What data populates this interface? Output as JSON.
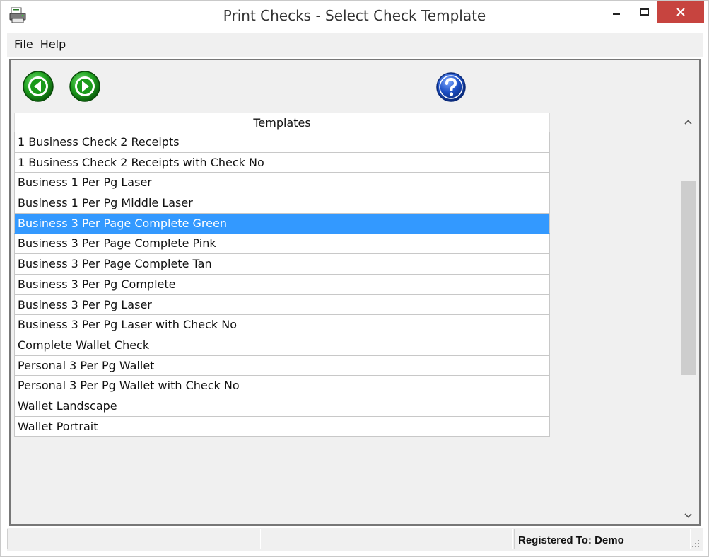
{
  "window": {
    "title": "Print Checks - Select Check Template"
  },
  "menu": {
    "items": [
      {
        "label": "File"
      },
      {
        "label": "Help"
      }
    ]
  },
  "toolbar": {
    "back_icon": "green-back-arrow-icon",
    "forward_icon": "green-forward-arrow-icon",
    "help_icon": "blue-question-icon"
  },
  "templates": {
    "header": "Templates",
    "selected_index": 4,
    "rows": [
      "1 Business Check 2 Receipts",
      "1 Business Check 2 Receipts with Check No",
      "Business 1 Per Pg Laser",
      "Business 1 Per Pg Middle Laser",
      "Business 3 Per Page Complete Green",
      "Business 3 Per Page Complete Pink",
      "Business 3 Per Page Complete Tan",
      "Business 3 Per Pg Complete",
      "Business 3 Per Pg Laser",
      "Business 3 Per Pg Laser with Check No",
      "Complete Wallet Check",
      "Personal 3 Per Pg Wallet",
      "Personal 3 Per Pg Wallet with Check No",
      "Wallet Landscape",
      "Wallet Portrait"
    ]
  },
  "status": {
    "registered": "Registered To: Demo"
  },
  "colors": {
    "selection": "#3399ff",
    "close_button": "#c7443f",
    "nav_green": "#1a9a1a",
    "help_blue": "#1d4fc4"
  }
}
